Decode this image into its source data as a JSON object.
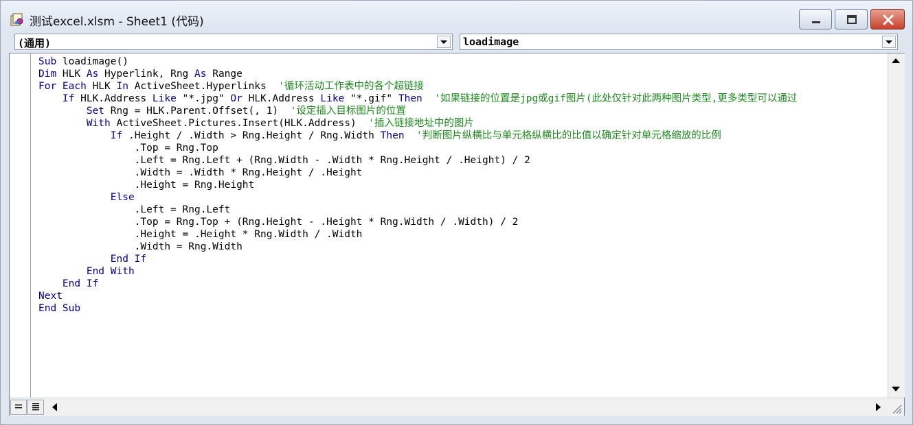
{
  "window": {
    "title": "测试excel.xlsm - Sheet1 (代码)",
    "icon": "vba-module-icon"
  },
  "selectors": {
    "object": "(通用)",
    "procedure": "loadimage"
  },
  "colors": {
    "keyword": "#00008b",
    "comment": "#1e8a1e",
    "text": "#000000"
  },
  "code_lines": [
    [
      {
        "t": "Sub",
        "k": "kw"
      },
      {
        "t": " loadimage()",
        "k": "tx"
      }
    ],
    [
      {
        "t": "Dim",
        "k": "kw"
      },
      {
        "t": " HLK ",
        "k": "tx"
      },
      {
        "t": "As",
        "k": "kw"
      },
      {
        "t": " Hyperlink, Rng ",
        "k": "tx"
      },
      {
        "t": "As",
        "k": "kw"
      },
      {
        "t": " Range",
        "k": "tx"
      }
    ],
    [
      {
        "t": "For Each",
        "k": "kw"
      },
      {
        "t": " HLK ",
        "k": "tx"
      },
      {
        "t": "In",
        "k": "kw"
      },
      {
        "t": " ActiveSheet.Hyperlinks  ",
        "k": "tx"
      },
      {
        "t": "'循环活动工作表中的各个超链接",
        "k": "cm"
      }
    ],
    [
      {
        "t": "    ",
        "k": "tx"
      },
      {
        "t": "If",
        "k": "kw"
      },
      {
        "t": " HLK.Address ",
        "k": "tx"
      },
      {
        "t": "Like",
        "k": "kw"
      },
      {
        "t": " \"*.jpg\" ",
        "k": "tx"
      },
      {
        "t": "Or",
        "k": "kw"
      },
      {
        "t": " HLK.Address ",
        "k": "tx"
      },
      {
        "t": "Like",
        "k": "kw"
      },
      {
        "t": " \"*.gif\" ",
        "k": "tx"
      },
      {
        "t": "Then",
        "k": "kw"
      },
      {
        "t": "  ",
        "k": "tx"
      },
      {
        "t": "'如果链接的位置是jpg或gif图片(此处仅针对此两种图片类型,更多类型可以通过",
        "k": "cm"
      }
    ],
    [
      {
        "t": "        ",
        "k": "tx"
      },
      {
        "t": "Set",
        "k": "kw"
      },
      {
        "t": " Rng = HLK.Parent.Offset(, 1)  ",
        "k": "tx"
      },
      {
        "t": "'设定插入目标图片的位置",
        "k": "cm"
      }
    ],
    [
      {
        "t": "        ",
        "k": "tx"
      },
      {
        "t": "With",
        "k": "kw"
      },
      {
        "t": " ActiveSheet.Pictures.Insert(HLK.Address)  ",
        "k": "tx"
      },
      {
        "t": "'插入链接地址中的图片",
        "k": "cm"
      }
    ],
    [
      {
        "t": "            ",
        "k": "tx"
      },
      {
        "t": "If",
        "k": "kw"
      },
      {
        "t": " .Height / .Width > Rng.Height / Rng.Width ",
        "k": "tx"
      },
      {
        "t": "Then",
        "k": "kw"
      },
      {
        "t": "  ",
        "k": "tx"
      },
      {
        "t": "'判断图片纵横比与单元格纵横比的比值以确定针对单元格缩放的比例",
        "k": "cm"
      }
    ],
    [
      {
        "t": "                .Top = Rng.Top",
        "k": "tx"
      }
    ],
    [
      {
        "t": "                .Left = Rng.Left + (Rng.Width - .Width * Rng.Height / .Height) / 2",
        "k": "tx"
      }
    ],
    [
      {
        "t": "                .Width = .Width * Rng.Height / .Height",
        "k": "tx"
      }
    ],
    [
      {
        "t": "                .Height = Rng.Height",
        "k": "tx"
      }
    ],
    [
      {
        "t": "            ",
        "k": "tx"
      },
      {
        "t": "Else",
        "k": "kw"
      }
    ],
    [
      {
        "t": "                .Left = Rng.Left",
        "k": "tx"
      }
    ],
    [
      {
        "t": "                .Top = Rng.Top + (Rng.Height - .Height * Rng.Width / .Width) / 2",
        "k": "tx"
      }
    ],
    [
      {
        "t": "                .Height = .Height * Rng.Width / .Width",
        "k": "tx"
      }
    ],
    [
      {
        "t": "                .Width = Rng.Width",
        "k": "tx"
      }
    ],
    [
      {
        "t": "            ",
        "k": "tx"
      },
      {
        "t": "End If",
        "k": "kw"
      }
    ],
    [
      {
        "t": "        ",
        "k": "tx"
      },
      {
        "t": "End With",
        "k": "kw"
      }
    ],
    [
      {
        "t": "    ",
        "k": "tx"
      },
      {
        "t": "End If",
        "k": "kw"
      }
    ],
    [
      {
        "t": "Next",
        "k": "kw"
      }
    ],
    [
      {
        "t": "End Sub",
        "k": "kw"
      }
    ]
  ]
}
